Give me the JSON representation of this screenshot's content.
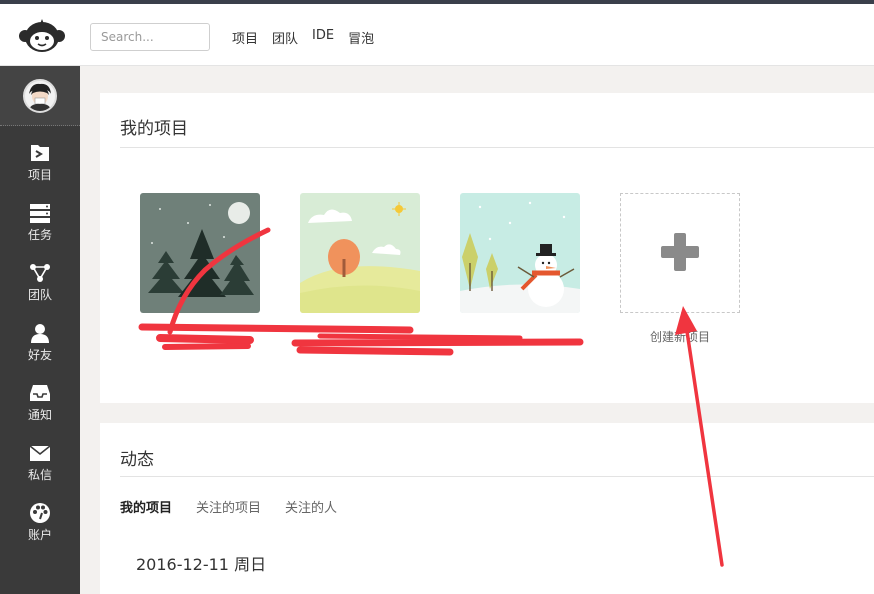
{
  "header": {
    "search_placeholder": "Search...",
    "nav": [
      "项目",
      "团队",
      "IDE",
      "冒泡"
    ]
  },
  "sidebar": {
    "items": [
      {
        "label": "项目",
        "icon": "folder-icon"
      },
      {
        "label": "任务",
        "icon": "tasks-icon"
      },
      {
        "label": "团队",
        "icon": "team-icon"
      },
      {
        "label": "好友",
        "icon": "user-icon"
      },
      {
        "label": "通知",
        "icon": "inbox-icon"
      },
      {
        "label": "私信",
        "icon": "mail-icon"
      },
      {
        "label": "账户",
        "icon": "palette-icon"
      }
    ]
  },
  "projects": {
    "title": "我的项目",
    "create_label": "创建新项目",
    "cards": [
      {
        "theme": "winter-forest"
      },
      {
        "theme": "autumn-tree"
      },
      {
        "theme": "snowman"
      }
    ]
  },
  "activity": {
    "title": "动态",
    "tabs": [
      "我的项目",
      "关注的项目",
      "关注的人"
    ],
    "active_tab": 0,
    "date": "2016-12-11 周日"
  },
  "colors": {
    "sidebar_bg": "#3a3a3a",
    "page_bg": "#f3f1ef",
    "annotation_red": "#f0353f"
  }
}
